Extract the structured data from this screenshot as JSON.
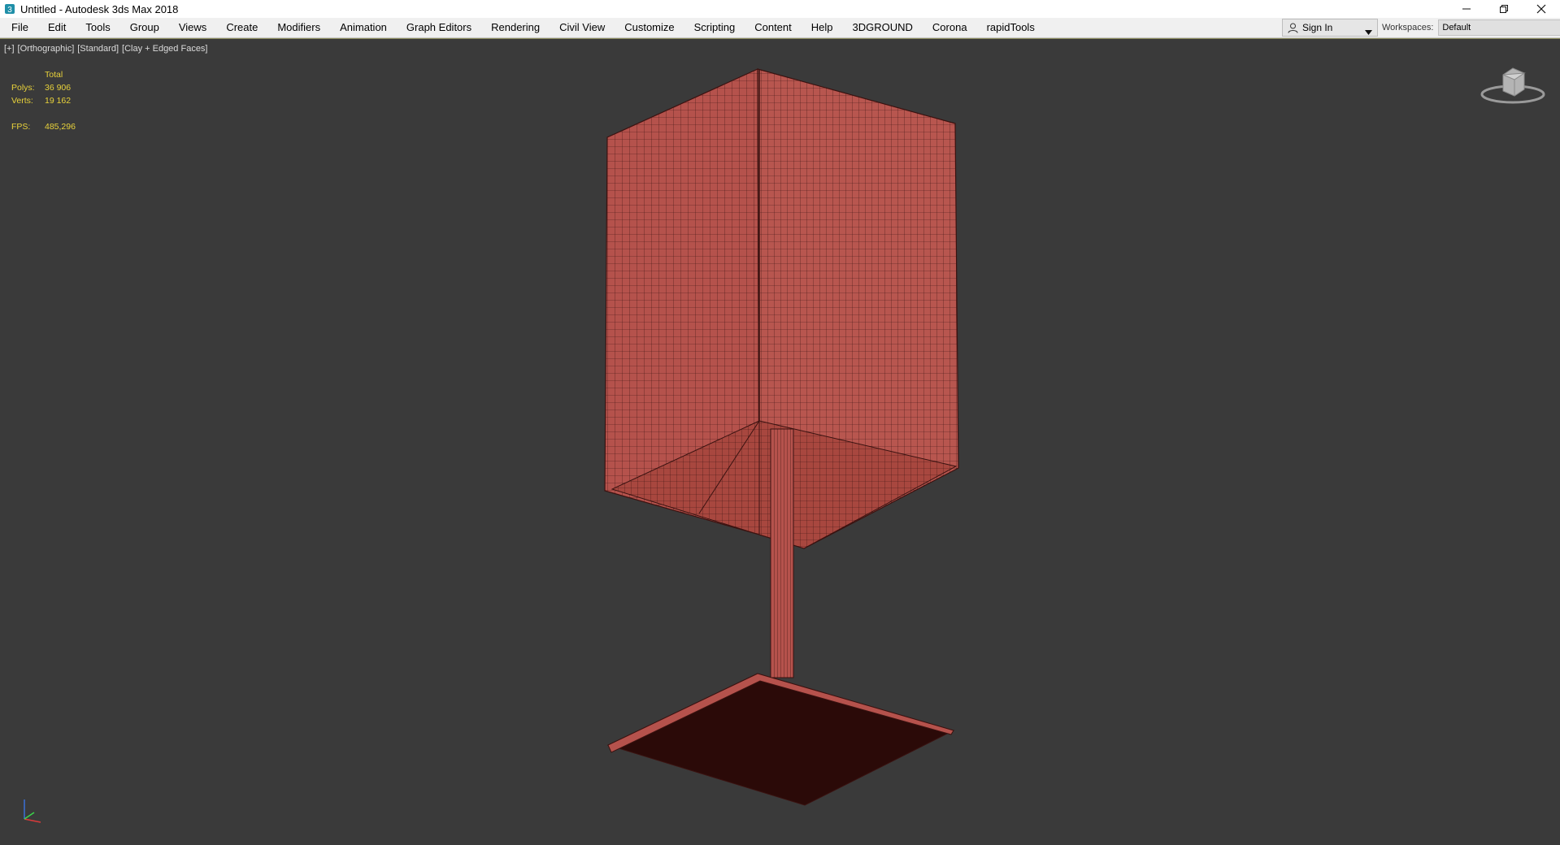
{
  "window": {
    "title": "Untitled - Autodesk 3ds Max 2018",
    "app_icon": "3ds-max-icon",
    "controls": [
      "minimize-icon",
      "restore-icon",
      "close-icon"
    ]
  },
  "menubar": {
    "items": [
      "File",
      "Edit",
      "Tools",
      "Group",
      "Views",
      "Create",
      "Modifiers",
      "Animation",
      "Graph Editors",
      "Rendering",
      "Civil View",
      "Customize",
      "Scripting",
      "Content",
      "Help",
      "3DGROUND",
      "Corona",
      "rapidTools"
    ],
    "sign_in": {
      "label": "Sign In",
      "icon": "user-icon"
    },
    "workspaces": {
      "label": "Workspaces:",
      "value": "Default"
    }
  },
  "viewport": {
    "label_parts": [
      "[+]",
      "[Orthographic]",
      "[Standard]",
      "[Clay + Edged Faces]"
    ],
    "stats": {
      "total_label": "Total",
      "polys_label": "Polys:",
      "polys_value": "36 906",
      "verts_label": "Verts:",
      "verts_value": "19 162",
      "fps_label": "FPS:",
      "fps_value": "485,296"
    },
    "background_color": "#3a3a3a",
    "model_color": "#b5524c",
    "wire_color": "#3a1210",
    "stats_color": "#e8d23a"
  }
}
